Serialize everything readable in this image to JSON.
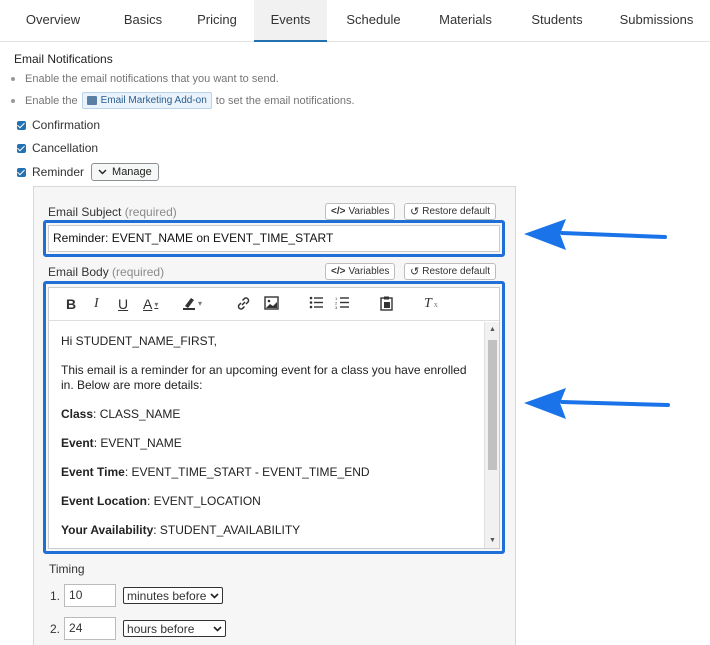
{
  "tabs": [
    {
      "label": "Overview"
    },
    {
      "label": "Basics"
    },
    {
      "label": "Pricing"
    },
    {
      "label": "Events"
    },
    {
      "label": "Schedule"
    },
    {
      "label": "Materials"
    },
    {
      "label": "Students"
    },
    {
      "label": "Submissions"
    }
  ],
  "active_tab": "Events",
  "email_notifications": {
    "title": "Email Notifications",
    "note1": "Enable the email notifications that you want to send.",
    "note2_prefix": "Enable the",
    "note2_addon": "Email Marketing Add-on",
    "note2_suffix": "to set the email notifications.",
    "options": [
      {
        "label": "Confirmation",
        "checked": true
      },
      {
        "label": "Cancellation",
        "checked": true
      },
      {
        "label": "Reminder",
        "checked": true
      }
    ],
    "manage_label": "Manage"
  },
  "email_subject": {
    "label": "Email Subject",
    "required": "(required)",
    "value": "Reminder: EVENT_NAME on EVENT_TIME_START",
    "variables_label": "Variables",
    "restore_label": "Restore default"
  },
  "email_body": {
    "label": "Email Body",
    "required": "(required)",
    "variables_label": "Variables",
    "restore_label": "Restore default",
    "greeting": "Hi STUDENT_NAME_FIRST,",
    "intro": "This email is a reminder for an upcoming event for a class you have enrolled in. Below are more details:",
    "details": [
      {
        "key": "Class",
        "value": ": CLASS_NAME"
      },
      {
        "key": "Event",
        "value": ": EVENT_NAME"
      },
      {
        "key": "Event Time",
        "value": ": EVENT_TIME_START - EVENT_TIME_END"
      },
      {
        "key": "Event Location",
        "value": ": EVENT_LOCATION"
      },
      {
        "key": "Your Availability",
        "value": ": STUDENT_AVAILABILITY"
      }
    ]
  },
  "timing": {
    "label": "Timing",
    "rows": [
      {
        "index": "1.",
        "value": "10",
        "unit": "minutes before"
      },
      {
        "index": "2.",
        "value": "24",
        "unit": "hours before"
      }
    ]
  },
  "colors": {
    "accent": "#2271b1",
    "highlight": "#1f6fd6",
    "arrow": "#1a73e8"
  }
}
